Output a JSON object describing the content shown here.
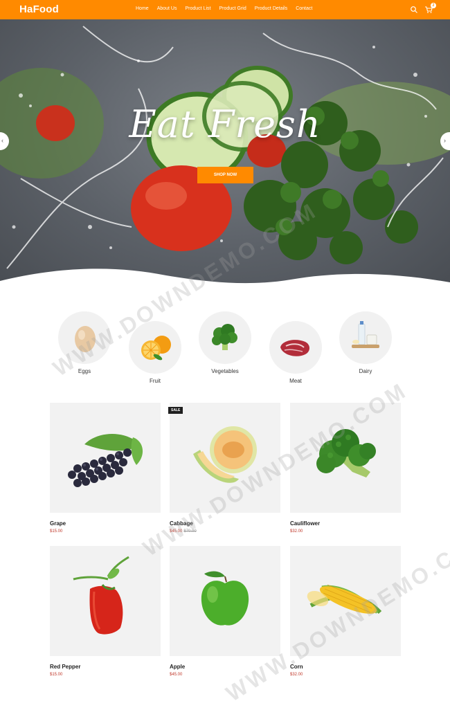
{
  "header": {
    "logo": "HaFood",
    "nav": [
      "Home",
      "About Us",
      "Product List",
      "Product Grid",
      "Product Details",
      "Contact"
    ],
    "cart_count": "2",
    "accent": "#ff8a00"
  },
  "hero": {
    "title": "Eat Fresh",
    "button": "SHOP NOW"
  },
  "categories": [
    {
      "label": "Eggs",
      "icon": "egg-icon"
    },
    {
      "label": "Fruit",
      "icon": "orange-icon"
    },
    {
      "label": "Vegetables",
      "icon": "broccoli-icon"
    },
    {
      "label": "Meat",
      "icon": "meat-icon"
    },
    {
      "label": "Dairy",
      "icon": "milk-icon"
    }
  ],
  "products": [
    {
      "name": "Grape",
      "price": "$15.00",
      "old_price": "",
      "badge": "",
      "image": "grape-image"
    },
    {
      "name": "Cabbage",
      "price": "$45.00",
      "old_price": "$70.00",
      "badge": "SALE",
      "image": "melon-image"
    },
    {
      "name": "Cauliflower",
      "price": "$32.00",
      "old_price": "",
      "badge": "",
      "image": "broccoli-image"
    },
    {
      "name": "Red Pepper",
      "price": "$15.00",
      "old_price": "",
      "badge": "",
      "image": "red-pepper-image"
    },
    {
      "name": "Apple",
      "price": "$45.00",
      "old_price": "",
      "badge": "",
      "image": "apple-image"
    },
    {
      "name": "Corn",
      "price": "$32.00",
      "old_price": "",
      "badge": "",
      "image": "corn-image"
    }
  ],
  "watermark": "WWW.DOWNDEMO.COM"
}
